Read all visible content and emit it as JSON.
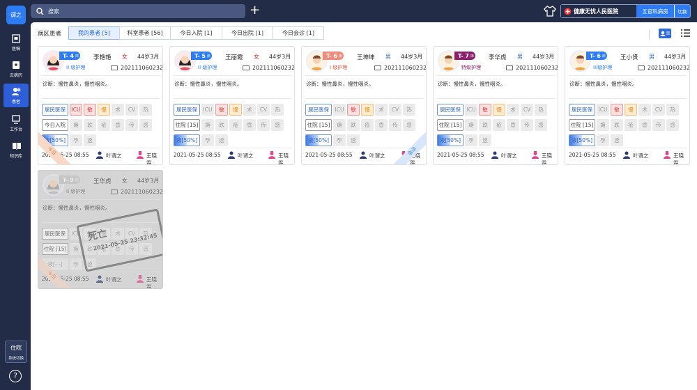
{
  "sidebar": {
    "logo": "谓之",
    "items": [
      {
        "label": "医嘱",
        "icon": "order-icon"
      },
      {
        "label": "云病历",
        "icon": "record-icon"
      },
      {
        "label": "患者",
        "icon": "patients-icon",
        "active": true
      },
      {
        "label": "工作台",
        "icon": "workbench-icon"
      },
      {
        "label": "知识库",
        "icon": "knowledge-icon"
      }
    ],
    "mode_label": "住院",
    "mode_switch": "系统切换",
    "help": "?"
  },
  "topbar": {
    "search_placeholder": "搜索",
    "add": "+",
    "hospital": "健康无忧人民医院",
    "department": "五官科病房",
    "switch": "切换"
  },
  "main": {
    "ward_label": "病区患者",
    "tabs": [
      "我的患者 [5]",
      "科室患者 [56]",
      "今日入院 [1]",
      "今日出院 [1]",
      "今日会诊 [1]"
    ],
    "active_tab": 0
  },
  "colors": {
    "accent": "#2d7cf6",
    "sidebar": "#232c46",
    "bed_blue": "#2d7cf6",
    "bed_purple": "#8b1f6a",
    "bed_red": "#f08a7a"
  },
  "patients": [
    {
      "bed": "T- 4",
      "bed_unit": "床",
      "name": "李艳艳",
      "sex": "女",
      "age": "44岁3月",
      "care": "II 级护理",
      "id": "202111060232",
      "diag": "诊断：慢性鼻炎，慢性咽炎。",
      "tags": [
        "居民医保",
        "ICU",
        "敏",
        "慢",
        "术",
        "CV",
        "热",
        "今日入院",
        "瘫",
        "跌",
        "疮",
        "昏",
        "传",
        "感",
        "液[50%]",
        "孕",
        "透"
      ],
      "fluid_fill": 0.5,
      "date": "2021-05-25",
      "time": "08:55",
      "doctor": "叶谓之",
      "nurse": "王晓霞",
      "ribbon": "今日"
    },
    {
      "bed": "T- 5",
      "bed_unit": "床",
      "name": "王丽霞",
      "sex": "女",
      "age": "44岁3月",
      "care": "II 级护理",
      "id": "202111060232",
      "diag": "诊断：慢性鼻炎，慢性咽炎。",
      "tags": [
        "居民医保",
        "ICU",
        "敏",
        "慢",
        "术",
        "CV",
        "热",
        "住院 [15]",
        "瘫",
        "跌",
        "疮",
        "昏",
        "传",
        "感",
        "液[50%]",
        "孕",
        "透"
      ],
      "fluid_fill": 0.5,
      "date": "2021-05-25",
      "time": "08:55",
      "doctor": "叶谓之",
      "nurse": "王晓霞"
    },
    {
      "bed": "T- 6",
      "bed_unit": "床",
      "name": "王坤坤",
      "sex": "男",
      "age": "44岁3月",
      "care": "I 级护理",
      "id": "202111060232",
      "diag": "诊断：慢性鼻炎，慢性咽炎。",
      "tags": [
        "居民医保",
        "ICU",
        "敏",
        "慢",
        "术",
        "CV",
        "热",
        "住院 [15]",
        "瘫",
        "跌",
        "疮",
        "昏",
        "传",
        "感",
        "液[50%]",
        "孕",
        "透"
      ],
      "fluid_fill": 0.5,
      "date": "2021-05-25",
      "time": "08:55",
      "doctor": "叶谓之",
      "nurse": "王晓霞",
      "ribbon_right": "会诊"
    },
    {
      "bed": "T- 7",
      "bed_unit": "床",
      "name": "李华虎",
      "sex": "男",
      "age": "44岁3月",
      "care": "特级护理",
      "id": "202111060232",
      "diag": "诊断：慢性鼻炎，慢性咽炎。",
      "tags": [
        "居民医保",
        "ICU",
        "敏",
        "慢",
        "术",
        "CV",
        "热",
        "住院 [15]",
        "瘫",
        "跌",
        "疮",
        "昏",
        "传",
        "感",
        "液[50%]",
        "孕",
        "透"
      ],
      "fluid_fill": 0.5,
      "date": "2021-05-25",
      "time": "08:55",
      "doctor": "叶谓之",
      "nurse": "王晓霞"
    },
    {
      "bed": "T- 6",
      "bed_unit": "床",
      "name": "王小贤",
      "sex": "男",
      "age": "44岁3月",
      "care": "III级护理",
      "id": "202111060232",
      "diag": "诊断：慢性鼻炎，慢性咽炎。",
      "tags": [
        "居民医保",
        "ICU",
        "敏",
        "慢",
        "术",
        "CV",
        "热",
        "住院 [15]",
        "瘫",
        "跌",
        "疮",
        "昏",
        "传",
        "感",
        "液[50%]",
        "孕",
        "透"
      ],
      "fluid_fill": 0.5,
      "date": "2021-05-25",
      "time": "08:55",
      "doctor": "叶谓之",
      "nurse": "王晓霞"
    },
    {
      "bed": "T- 9",
      "bed_unit": "床",
      "name": "王华虎",
      "sex": "女",
      "age": "44岁3月",
      "care": "II 级护理",
      "id": "202111060232",
      "diag": "诊断：慢性鼻炎，慢性咽炎。",
      "tags": [
        "居民医保",
        "ICU",
        "敏",
        "慢",
        "术",
        "CV",
        "热",
        "住院 [15]",
        "瘫",
        "跌",
        "疮",
        "昏",
        "传",
        "感",
        "液[- -]",
        "孕",
        "透"
      ],
      "date": "2021-05-25",
      "time": "08:55",
      "doctor": "叶谓之",
      "nurse": "王晓霞",
      "ribbon": "今日",
      "stamp_text": "死亡",
      "stamp_time": "2021-05-25 23:32:45"
    }
  ]
}
